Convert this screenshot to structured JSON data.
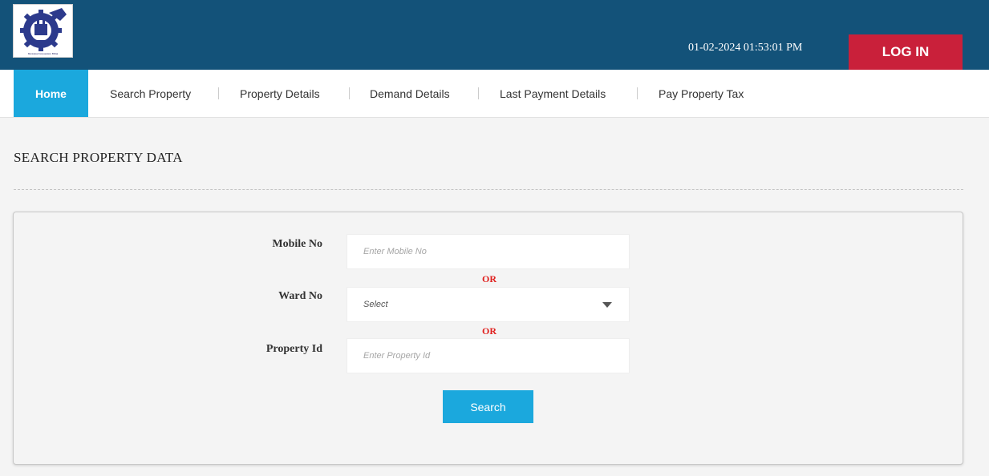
{
  "header": {
    "logo_text": "Municipal Corporation Bhilai",
    "datetime": "01-02-2024 01:53:01 PM",
    "login_label": "LOG IN"
  },
  "nav": {
    "items": [
      {
        "label": "Home"
      },
      {
        "label": "Search Property"
      },
      {
        "label": "Property Details"
      },
      {
        "label": "Demand Details"
      },
      {
        "label": "Last Payment Details"
      },
      {
        "label": "Pay Property Tax"
      }
    ]
  },
  "page": {
    "title": "SEARCH PROPERTY DATA"
  },
  "form": {
    "mobile": {
      "label": "Mobile No",
      "placeholder": "Enter Mobile No"
    },
    "or_1": "OR",
    "ward": {
      "label": "Ward No",
      "selected": "Select"
    },
    "or_2": "OR",
    "property": {
      "label": "Property Id",
      "placeholder": "Enter Property Id"
    },
    "search_label": "Search"
  },
  "colors": {
    "header_bg": "#135279",
    "login_bg": "#c9203a",
    "accent": "#1ba8dd",
    "or_text": "#e0201e"
  }
}
